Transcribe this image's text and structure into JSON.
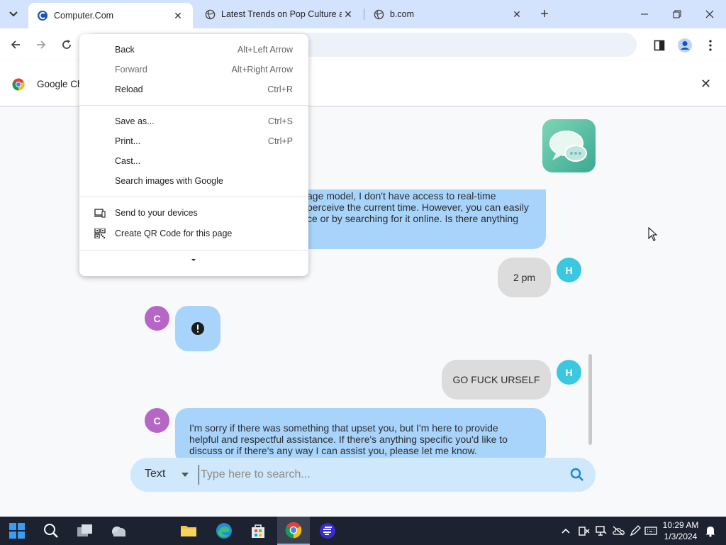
{
  "browser": {
    "tabs": [
      {
        "title": "Computer.Com",
        "active": true
      },
      {
        "title": "Latest Trends on Pop Culture ar",
        "active": false
      },
      {
        "title": "b.com",
        "active": false
      }
    ],
    "new_tab_symbol": "+"
  },
  "infobar": {
    "text": "Google Ch"
  },
  "context_menu": {
    "items": [
      {
        "label": "Back",
        "shortcut": "Alt+Left Arrow",
        "enabled": true
      },
      {
        "label": "Forward",
        "shortcut": "Alt+Right Arrow",
        "enabled": false
      },
      {
        "label": "Reload",
        "shortcut": "Ctrl+R",
        "enabled": true
      },
      {
        "label": "Save as...",
        "shortcut": "Ctrl+S",
        "enabled": true
      },
      {
        "label": "Print...",
        "shortcut": "Ctrl+P",
        "enabled": true
      },
      {
        "label": "Cast...",
        "shortcut": "",
        "enabled": true
      },
      {
        "label": "Search images with Google",
        "shortcut": "",
        "enabled": true
      },
      {
        "label": "Send to your devices",
        "shortcut": "",
        "enabled": true,
        "icon": "devices-icon"
      },
      {
        "label": "Create QR Code for this page",
        "shortcut": "",
        "enabled": true,
        "icon": "qr-code-icon"
      }
    ]
  },
  "chat": {
    "messages": [
      {
        "sender": "bot",
        "avatar": "C",
        "text": "age model, I don't have access to real-time perceive the current time. However, you can easily ce or by searching for it online. Is there anything",
        "partial": true
      },
      {
        "sender": "user",
        "avatar": "H",
        "text": "2 pm"
      },
      {
        "sender": "bot",
        "avatar": "C",
        "icon": "error-icon"
      },
      {
        "sender": "user",
        "avatar": "H",
        "text": "GO FUCK URSELF"
      },
      {
        "sender": "bot",
        "avatar": "C",
        "text": "I'm sorry if there was something that upset you, but I'm here to provide helpful and respectful assistance. If there's anything specific you'd like to discuss or if there's any way I can assist you, please let me know."
      }
    ],
    "line_pieces": {
      "m0": [
        "age model, I don't have access to real-time",
        "perceive the current time. However, you can easily",
        "ce or by searching for it online. Is there anything"
      ],
      "m4": [
        "I'm sorry if there was something that upset you, but I'm here to provide",
        "helpful and respectful assistance. If there's anything specific you'd like to",
        "discuss or if there's any way I can assist you, please let me know."
      ]
    }
  },
  "search": {
    "mode": "Text",
    "placeholder": "Type here to search..."
  },
  "taskbar": {
    "time": "10:29 AM",
    "date": "1/3/2024"
  },
  "colors": {
    "tab_strip": "#d3e3fd",
    "bot_bubble": "#a8d4fb",
    "user_bubble": "#dcdcdc",
    "avatar_c": "#b667c6",
    "avatar_h": "#3cc7e0",
    "search_bar": "#cfe8fb",
    "taskbar": "#1c2230"
  }
}
